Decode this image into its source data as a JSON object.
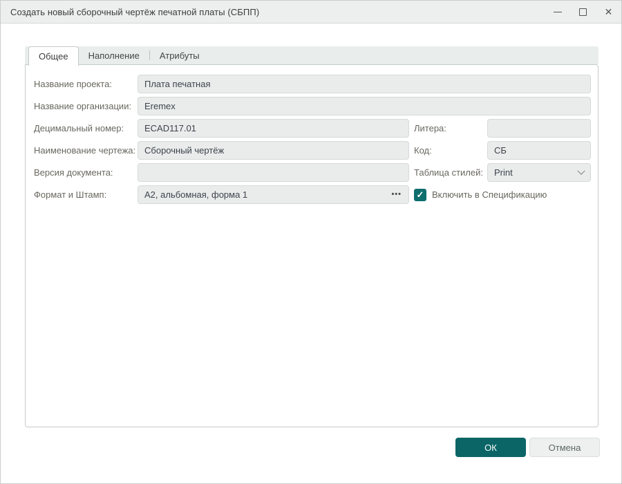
{
  "window": {
    "title": "Создать новый сборочный чертёж печатной платы (СБПП)"
  },
  "icons": {
    "minimize": "minimize-line",
    "maximize": "maximize-square",
    "close": "✕",
    "check": "✓",
    "chevron_down": "chevron-down",
    "ellipsis": "•••"
  },
  "tabs": [
    {
      "label": "Общее",
      "active": true
    },
    {
      "label": "Наполнение",
      "active": false
    },
    {
      "label": "Атрибуты",
      "active": false
    }
  ],
  "form": {
    "project_name": {
      "label": "Название проекта:",
      "value": "Плата печатная"
    },
    "organization_name": {
      "label": "Название организации:",
      "value": "Eremex"
    },
    "decimal_number": {
      "label": "Децимальный номер:",
      "value": "ECAD117.01"
    },
    "litera": {
      "label": "Литера:",
      "value": ""
    },
    "drawing_name": {
      "label": "Наименование чертежа:",
      "value": "Сборочный чертёж"
    },
    "code": {
      "label": "Код:",
      "value": "СБ"
    },
    "document_version": {
      "label": "Версия документа:",
      "value": ""
    },
    "style_table": {
      "label": "Таблица стилей:",
      "value": "Print"
    },
    "format_stamp": {
      "label": "Формат и Штамп:",
      "value": "А2, альбомная, форма 1"
    },
    "include_spec": {
      "label": "Включить в Спецификацию",
      "checked": true
    }
  },
  "footer": {
    "ok_label": "ОК",
    "cancel_label": "Отмена"
  },
  "colors": {
    "accent_teal": "#0b6566",
    "checkbox_teal": "#0e6e6e",
    "titlebar_bg": "#ecefee",
    "input_bg": "#e9eceb",
    "input_border": "#d4dad8",
    "label_text": "#68675f"
  }
}
